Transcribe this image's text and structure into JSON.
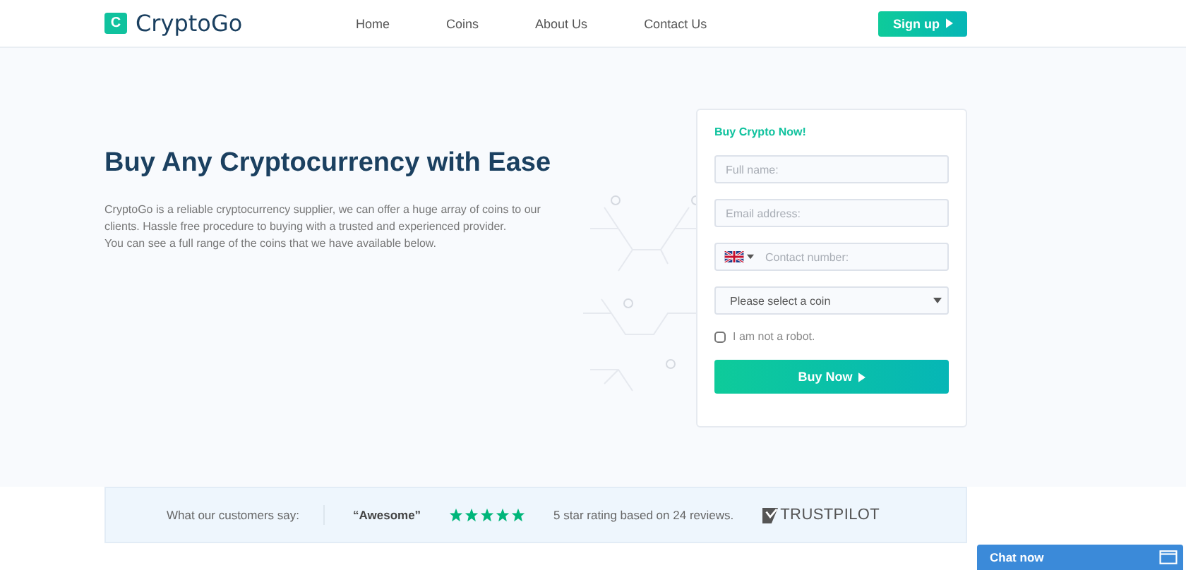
{
  "header": {
    "logo_letter": "C",
    "logo_text": "CryptoGo",
    "nav": [
      {
        "label": "Home"
      },
      {
        "label": "Coins"
      },
      {
        "label": "About Us"
      },
      {
        "label": "Contact Us"
      }
    ],
    "signup": "Sign up"
  },
  "hero": {
    "title": "Buy Any Cryptocurrency with Ease",
    "text": "CryptoGo is a reliable cryptocurrency supplier, we can offer a huge array of coins to our clients. Hassle free procedure to buying with a trusted and experienced provider.\nYou can see a full range of the coins that we have available below."
  },
  "form": {
    "title": "Buy Crypto Now!",
    "fields": [
      {
        "kind": "text",
        "placeholder": "Full name:"
      },
      {
        "kind": "text",
        "placeholder": "Email address:"
      },
      {
        "kind": "phone",
        "placeholder": "Contact number:"
      },
      {
        "kind": "select",
        "value": "Please select a coin"
      }
    ],
    "robot": {
      "label": "I am not a robot.",
      "checked": false
    },
    "button": "Buy Now"
  },
  "reviews": {
    "label": "What our customers say:",
    "quote": "“Awesome”",
    "stars": 5,
    "summary": "5 star rating based on 24 reviews.",
    "brand": "TRUSTPILOT"
  },
  "chat": {
    "label": "Chat now"
  }
}
